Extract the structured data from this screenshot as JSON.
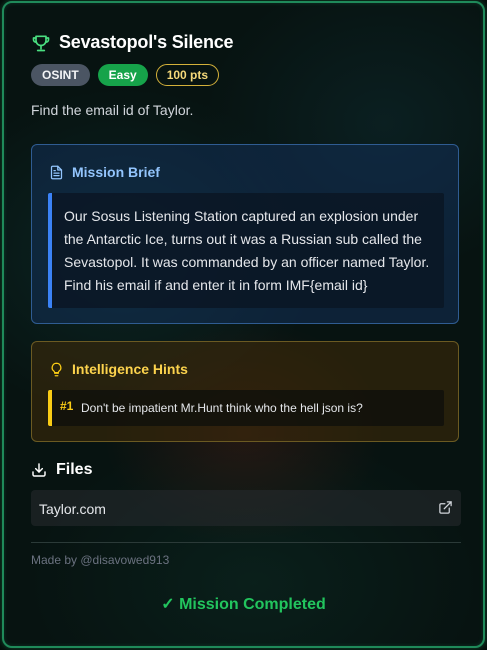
{
  "challenge": {
    "title": "Sevastopol's Silence",
    "category": "OSINT",
    "difficulty": "Easy",
    "points": "100 pts",
    "description": "Find the email id of Taylor."
  },
  "mission_brief": {
    "heading": "Mission Brief",
    "body": "Our Sosus Listening Station captured an explosion under the Antarctic Ice, turns out it was a Russian sub called the Sevastopol. It was commanded by an officer named Taylor. Find his email if and enter it in form IMF{email id}"
  },
  "hints": {
    "heading": "Intelligence Hints",
    "items": [
      {
        "number": "#1",
        "text": "Don't be impatient Mr.Hunt think who the hell json is?"
      }
    ]
  },
  "files": {
    "heading": "Files",
    "items": [
      {
        "name": "Taylor.com"
      }
    ]
  },
  "footer": {
    "credit": "Made by @disavowed913",
    "status": "✓ Mission Completed"
  },
  "colors": {
    "accent_green": "#22c55e",
    "brief_blue": "#3b82f6",
    "hint_yellow": "#facc15",
    "border_green": "#1f8a5a"
  },
  "icons": {
    "title": "trophy-icon",
    "brief": "document-icon",
    "hints": "lightbulb-icon",
    "files": "download-icon",
    "file_link": "external-link-icon"
  }
}
